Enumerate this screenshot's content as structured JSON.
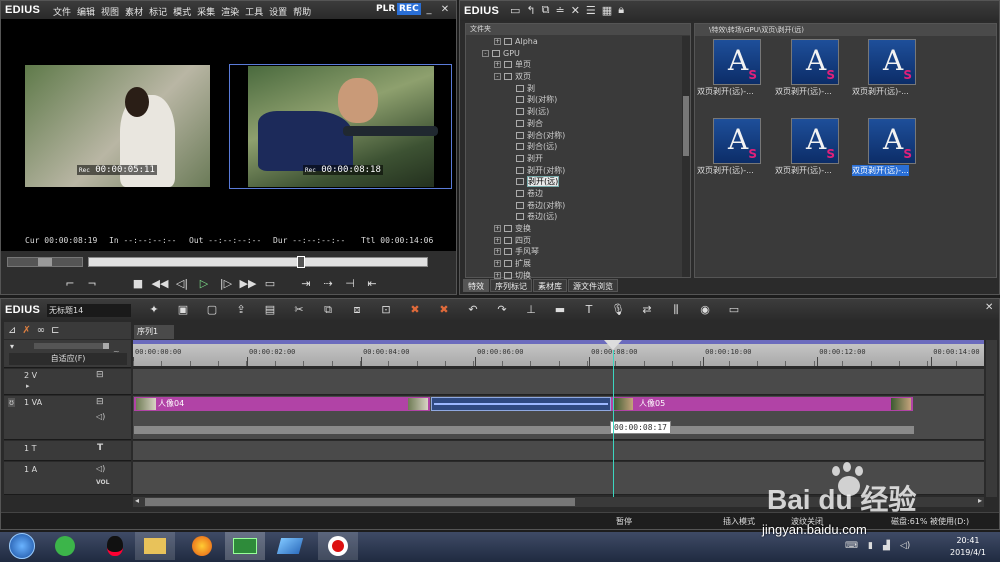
{
  "player": {
    "logo": "EDIUS",
    "menu": [
      "文件",
      "编辑",
      "视图",
      "素材",
      "标记",
      "模式",
      "采集",
      "渲染",
      "工具",
      "设置",
      "帮助"
    ],
    "mode_plr": "PLR",
    "mode_rec": "REC",
    "source_tc": "00:00:05:11",
    "record_tc": "00:00:08:18",
    "tc_prefix": "Rec",
    "cur_label": "Cur",
    "cur": "00:00:08:19",
    "in_label": "In",
    "in": "--:--:--:--",
    "out_label": "Out",
    "out": "--:--:--:--",
    "dur_label": "Dur",
    "dur": "--:--:--:--",
    "ttl_label": "Ttl",
    "ttl": "00:00:14:06",
    "scrub_position": 0.615
  },
  "effects": {
    "logo": "EDIUS",
    "folder_header": "文件夹",
    "path": "\\特效\\转场\\GPU\\双页\\剥开(远)",
    "tree": [
      {
        "label": "Alpha",
        "indent": 2,
        "pm": "+"
      },
      {
        "label": "GPU",
        "indent": 1,
        "pm": "-"
      },
      {
        "label": "单页",
        "indent": 2,
        "pm": "+"
      },
      {
        "label": "双页",
        "indent": 2,
        "pm": "-"
      },
      {
        "label": "剥",
        "indent": 3
      },
      {
        "label": "剥(对称)",
        "indent": 3
      },
      {
        "label": "剥(远)",
        "indent": 3
      },
      {
        "label": "剥合",
        "indent": 3
      },
      {
        "label": "剥合(对称)",
        "indent": 3
      },
      {
        "label": "剥合(远)",
        "indent": 3
      },
      {
        "label": "剥开",
        "indent": 3
      },
      {
        "label": "剥开(对称)",
        "indent": 3
      },
      {
        "label": "剥开(远)",
        "indent": 3,
        "selected": true
      },
      {
        "label": "卷边",
        "indent": 3
      },
      {
        "label": "卷边(对称)",
        "indent": 3
      },
      {
        "label": "卷边(远)",
        "indent": 3
      },
      {
        "label": "变换",
        "indent": 2,
        "pm": "+"
      },
      {
        "label": "四页",
        "indent": 2,
        "pm": "+"
      },
      {
        "label": "手风琴",
        "indent": 2,
        "pm": "+"
      },
      {
        "label": "扩展",
        "indent": 2,
        "pm": "+"
      },
      {
        "label": "切换",
        "indent": 2,
        "pm": "+"
      }
    ],
    "thumbs": [
      "双页剥开(远)-...",
      "双页剥开(远)-...",
      "双页剥开(远)-...",
      "双页剥开(远)-...",
      "双页剥开(远)-...",
      "双页剥开(远)-..."
    ],
    "thumb_glyph": "A",
    "thumb_badge": "S",
    "tabs": [
      "特效",
      "序列标记",
      "素材库",
      "源文件浏览"
    ]
  },
  "timeline": {
    "logo": "EDIUS",
    "project": "无标题14",
    "sequence_tab": "序列1",
    "fit_label": "自适应(F)",
    "ruler": [
      "00:00:00:00",
      "00:00:02:00",
      "00:00:04:00",
      "00:00:06:00",
      "00:00:08:00",
      "00:00:10:00",
      "00:00:12:00",
      "00:00:14:00"
    ],
    "tracks": {
      "v2": "2 V",
      "va1": "1 VA",
      "t1": "1 T",
      "a1": "1 A",
      "vol": "VOL"
    },
    "clip_a": "人像04",
    "clip_b": "人像05",
    "tooltip": "00:00:08:17"
  },
  "status": {
    "pause": "暂停",
    "insert_mode": "插入模式",
    "ripple": "波纹关闭",
    "disk": "磁盘:61% 被使用(D:)"
  },
  "taskbar": {
    "time": "20:41",
    "date": "2019/4/1"
  },
  "watermark": {
    "brand": "Bai du 经验",
    "url": "jingyan.baidu.com"
  }
}
